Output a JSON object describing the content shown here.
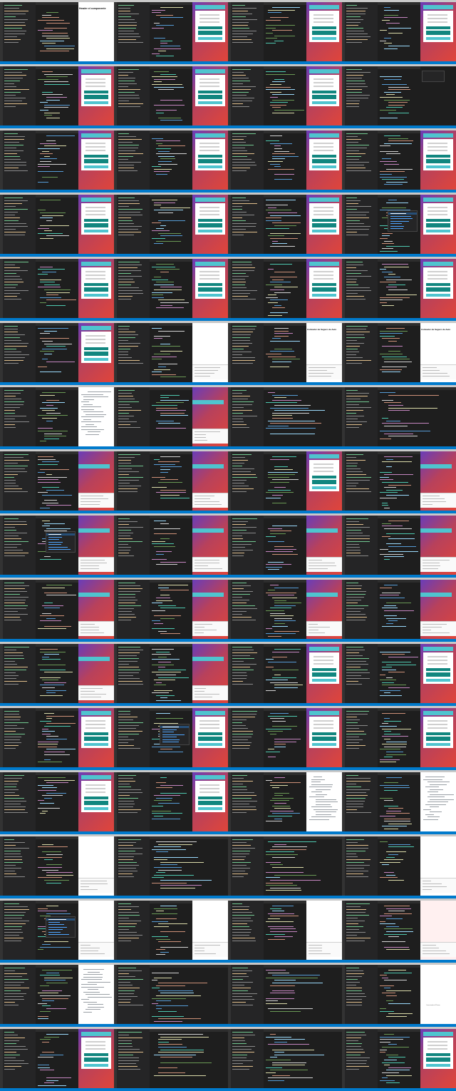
{
  "grid": {
    "columns": 4,
    "rows": 17
  },
  "app": {
    "project_title": "Cotizador de Seguro de Auto",
    "component_heading": "Header el componente",
    "status_text": "Conectando al Phaser"
  },
  "colors": {
    "editor_bg": "#1e1e1e",
    "sidebar_bg": "#252526",
    "statusbar": "#007acc",
    "gradient_start": "#6a3db8",
    "gradient_end": "#e0453a",
    "header_teal": "#4fc4cf",
    "button_dark_teal": "#11867f"
  },
  "tiles": [
    {
      "view": "split",
      "browser": "white",
      "title": "app.component_heading"
    },
    {
      "view": "split",
      "browser": "card"
    },
    {
      "view": "split",
      "browser": "card"
    },
    {
      "view": "split",
      "browser": "card"
    },
    {
      "view": "split",
      "browser": "card-wide"
    },
    {
      "view": "split",
      "browser": "grad-card"
    },
    {
      "view": "split",
      "browser": "grad-card"
    },
    {
      "view": "split",
      "browser": "code-popup"
    },
    {
      "view": "split",
      "browser": "grad-card"
    },
    {
      "view": "split",
      "browser": "grad-card"
    },
    {
      "view": "split",
      "browser": "grad-card"
    },
    {
      "view": "split",
      "browser": "grad-card"
    },
    {
      "view": "split",
      "browser": "grad-card"
    },
    {
      "view": "split",
      "browser": "grad-card"
    },
    {
      "view": "split",
      "browser": "grad-card"
    },
    {
      "view": "split",
      "browser": "grad-card",
      "popup": true
    },
    {
      "view": "split",
      "browser": "grad-card"
    },
    {
      "view": "split",
      "browser": "grad-card"
    },
    {
      "view": "split",
      "browser": "grad-card"
    },
    {
      "view": "split",
      "browser": "grad-card"
    },
    {
      "view": "split",
      "browser": "grad-card"
    },
    {
      "view": "split",
      "browser": "white-devtools"
    },
    {
      "view": "split",
      "browser": "white-title",
      "title": "app.project_title"
    },
    {
      "view": "split",
      "browser": "white-title",
      "title": "app.project_title"
    },
    {
      "view": "split",
      "browser": "doc"
    },
    {
      "view": "split",
      "browser": "grad-devtools"
    },
    {
      "view": "code",
      "browser": "none"
    },
    {
      "view": "code",
      "browser": "none"
    },
    {
      "view": "split",
      "browser": "grad-header"
    },
    {
      "view": "split",
      "browser": "grad-header"
    },
    {
      "view": "split",
      "browser": "card"
    },
    {
      "view": "split",
      "browser": "grad-header"
    },
    {
      "view": "split",
      "browser": "grad-header",
      "popup": true
    },
    {
      "view": "split",
      "browser": "grad-header"
    },
    {
      "view": "split",
      "browser": "grad-header"
    },
    {
      "view": "split",
      "browser": "grad-status",
      "status": "app.status_text"
    },
    {
      "view": "split",
      "browser": "grad-header"
    },
    {
      "view": "split",
      "browser": "grad-header"
    },
    {
      "view": "split",
      "browser": "grad-header"
    },
    {
      "view": "split",
      "browser": "grad-header"
    },
    {
      "view": "split",
      "browser": "grad-header"
    },
    {
      "view": "split",
      "browser": "grad-header"
    },
    {
      "view": "split",
      "browser": "card"
    },
    {
      "view": "split",
      "browser": "grad-card"
    },
    {
      "view": "split",
      "browser": "grad-card"
    },
    {
      "view": "split",
      "browser": "grad-card",
      "popup": true
    },
    {
      "view": "split",
      "browser": "grad-card"
    },
    {
      "view": "split",
      "browser": "grad-card"
    },
    {
      "view": "split",
      "browser": "grad-card"
    },
    {
      "view": "split",
      "browser": "grad-card"
    },
    {
      "view": "split",
      "browser": "doc"
    },
    {
      "view": "split",
      "browser": "doc"
    },
    {
      "view": "split",
      "browser": "white-devtools"
    },
    {
      "view": "code",
      "browser": "none"
    },
    {
      "view": "code",
      "browser": "none"
    },
    {
      "view": "split",
      "browser": "white-devtools"
    },
    {
      "view": "split",
      "browser": "white-devtools",
      "popup": true
    },
    {
      "view": "split",
      "browser": "white-devtools"
    },
    {
      "view": "split",
      "browser": "white-devtools"
    },
    {
      "view": "split",
      "browser": "pink-devtools"
    },
    {
      "view": "split",
      "browser": "doc"
    },
    {
      "view": "code",
      "browser": "none"
    },
    {
      "view": "code",
      "browser": "none"
    },
    {
      "view": "split",
      "browser": "white-status",
      "status": "app.status_text"
    },
    {
      "view": "split",
      "browser": "card"
    },
    {
      "view": "code",
      "browser": "none"
    },
    {
      "view": "code",
      "browser": "none"
    },
    {
      "view": "split",
      "browser": "card"
    }
  ]
}
